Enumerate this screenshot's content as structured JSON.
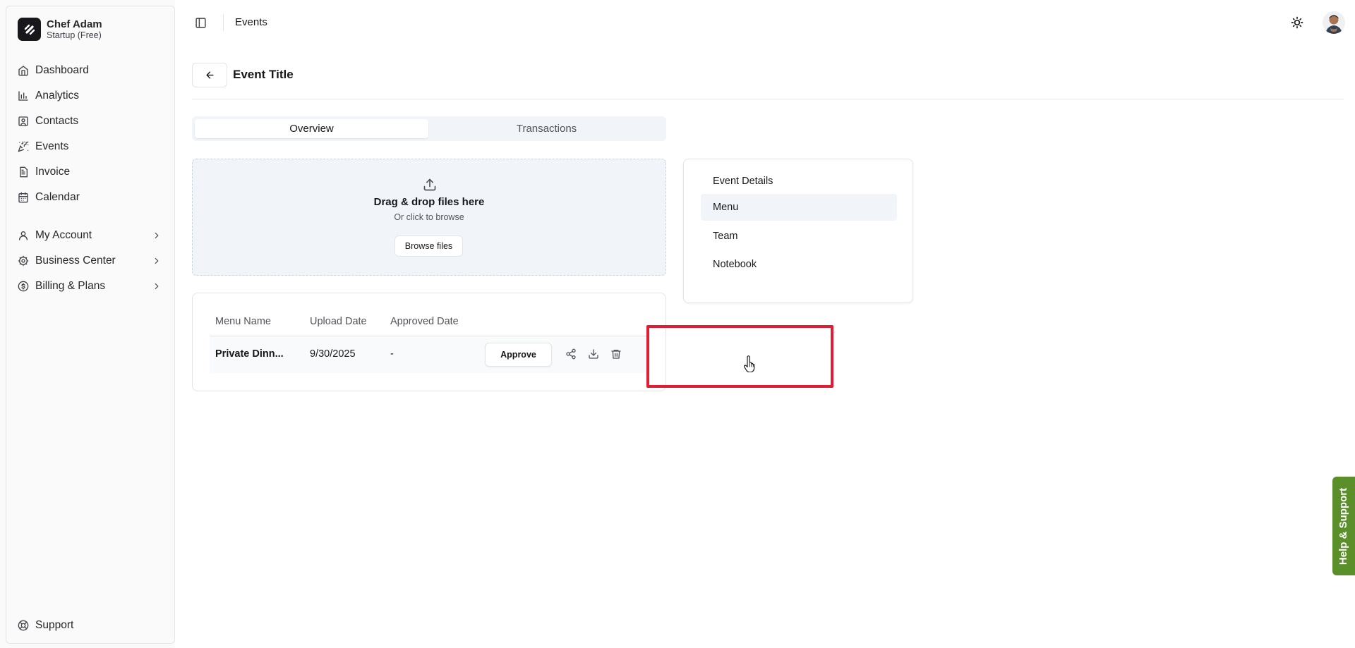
{
  "sidebar": {
    "brand": {
      "name": "Chef Adam",
      "plan": "Startup (Free)"
    },
    "items": [
      {
        "label": "Dashboard",
        "icon": "home-icon"
      },
      {
        "label": "Analytics",
        "icon": "bar-chart-icon"
      },
      {
        "label": "Contacts",
        "icon": "contact-icon"
      },
      {
        "label": "Events",
        "icon": "party-popper-icon"
      },
      {
        "label": "Invoice",
        "icon": "file-text-icon"
      },
      {
        "label": "Calendar",
        "icon": "calendar-icon"
      }
    ],
    "expandable": [
      {
        "label": "My Account",
        "icon": "user-icon"
      },
      {
        "label": "Business Center",
        "icon": "settings-icon"
      },
      {
        "label": "Billing & Plans",
        "icon": "dollar-circle-icon"
      }
    ],
    "footer": {
      "label": "Support",
      "icon": "life-buoy-icon"
    }
  },
  "header": {
    "breadcrumb": "Events"
  },
  "page": {
    "title": "Event Title"
  },
  "tabs": [
    {
      "label": "Overview",
      "active": true
    },
    {
      "label": "Transactions",
      "active": false
    }
  ],
  "upload": {
    "title": "Drag & drop files here",
    "subtitle": "Or click to browse",
    "button": "Browse files"
  },
  "menu_table": {
    "columns": [
      "Menu Name",
      "Upload Date",
      "Approved Date"
    ],
    "rows": [
      {
        "name": "Private Dinn...",
        "upload_date": "9/30/2025",
        "approved_date": "-",
        "action": "Approve"
      }
    ]
  },
  "details_nav": {
    "items": [
      "Event Details",
      "Menu",
      "Team",
      "Notebook"
    ],
    "selected": "Menu"
  },
  "help": {
    "label": "Help & Support"
  },
  "colors": {
    "highlight": "#e11d34",
    "help_bg": "#5a8f29"
  }
}
